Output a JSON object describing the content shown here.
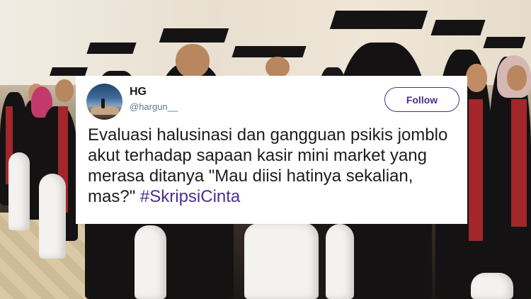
{
  "tweet": {
    "display_name": "HG",
    "handle": "@hargun__",
    "follow_label": "Follow",
    "text": "Evaluasi halusinasi dan gangguan psikis jomblo akut terhadap sapaan kasir mini market yang merasa ditanya \"Mau diisi hatinya sekalian, mas?\"",
    "hashtag": "#SkripsiCinta"
  },
  "colors": {
    "accent": "#4a2f8f",
    "card_background": "#ffffff",
    "text": "#1c1c1c",
    "handle": "#657786"
  },
  "background": {
    "scene": "graduation ceremony photo"
  }
}
